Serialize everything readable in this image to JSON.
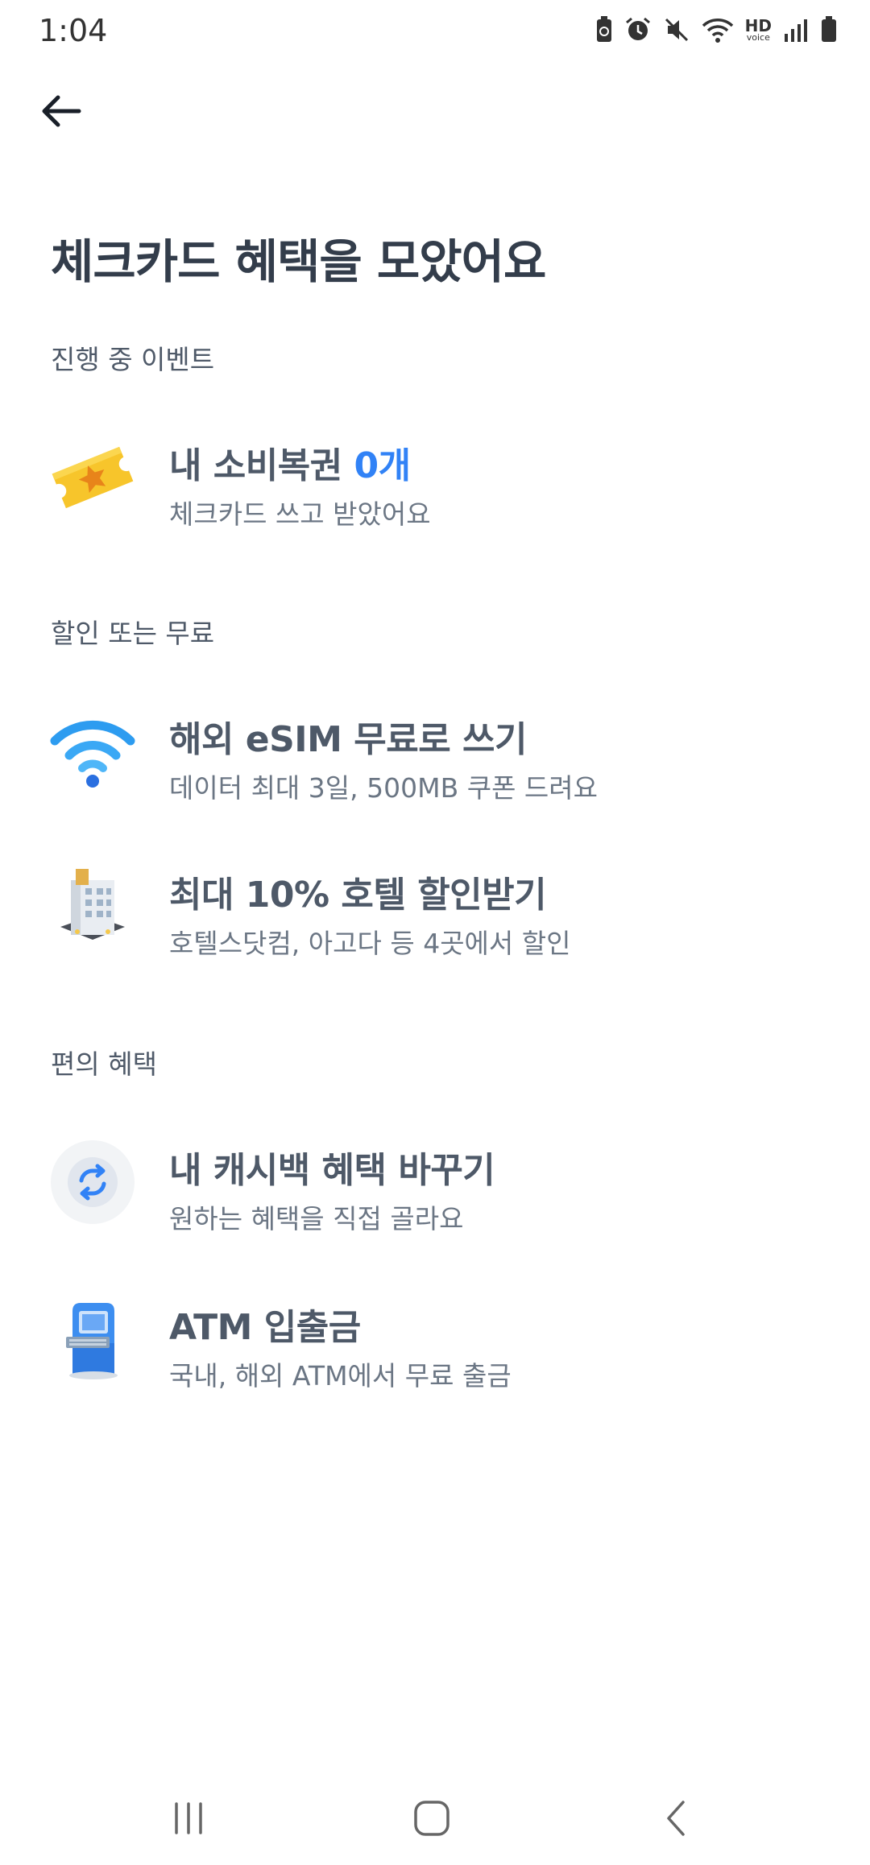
{
  "status_bar": {
    "time": "1:04",
    "hd_label": "HD",
    "voice_label": "voice",
    "icons": [
      "battery-saver-icon",
      "alarm-icon",
      "mute-icon",
      "wifi-icon",
      "hd-voice-icon",
      "signal-icon",
      "battery-icon"
    ]
  },
  "header": {
    "back_icon": "back-arrow-icon"
  },
  "page": {
    "title": "체크카드 혜택을 모았어요"
  },
  "sections": [
    {
      "label": "진행 중 이벤트",
      "items": [
        {
          "icon": "ticket-icon",
          "title": "내 소비복권 ",
          "title_accent": "0개",
          "subtitle": "체크카드 쓰고 받았어요"
        }
      ]
    },
    {
      "label": "할인 또는 무료",
      "items": [
        {
          "icon": "wifi-icon",
          "title": "해외 eSIM 무료로 쓰기",
          "subtitle": "데이터 최대 3일, 500MB 쿠폰 드려요"
        },
        {
          "icon": "hotel-icon",
          "title": "최대 10% 호텔 할인받기",
          "subtitle": "호텔스닷컴, 아고다 등 4곳에서 할인"
        }
      ]
    },
    {
      "label": "편의 혜택",
      "items": [
        {
          "icon": "refresh-icon",
          "title": "내 캐시백 혜택 바꾸기",
          "subtitle": "원하는 혜택을 직접 골라요"
        },
        {
          "icon": "atm-icon",
          "title": "ATM 입출금",
          "subtitle": "국내, 해외 ATM에서 무료 출금"
        }
      ]
    }
  ],
  "colors": {
    "accent": "#3182f6",
    "title_text": "#333d4b",
    "body_text": "#4e5968",
    "sub_text": "#6b7684"
  },
  "nav_bar": {
    "icons": [
      "recent-apps-icon",
      "home-icon",
      "back-icon"
    ]
  }
}
